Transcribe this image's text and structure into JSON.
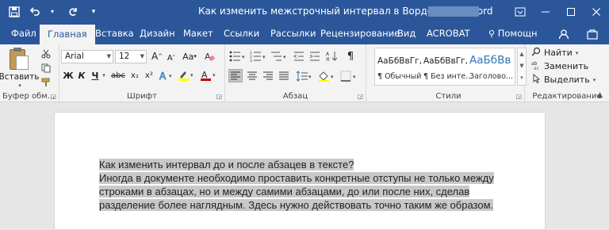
{
  "window": {
    "title": "Как изменить межстрочный интервал в Ворде.docx - Word",
    "buttons": [
      "ribbon-display-icon",
      "minimize-icon",
      "maximize-icon",
      "close-icon"
    ]
  },
  "qat": {
    "icons": [
      "save-icon",
      "undo-icon",
      "redo-icon",
      "customize-icon"
    ]
  },
  "tabs": [
    {
      "label": "Файл"
    },
    {
      "label": "Главная"
    },
    {
      "label": "Вставка"
    },
    {
      "label": "Дизайн"
    },
    {
      "label": "Макет"
    },
    {
      "label": "Ссылки"
    },
    {
      "label": "Рассылки"
    },
    {
      "label": "Рецензирование"
    },
    {
      "label": "Вид"
    },
    {
      "label": "ACROBAT"
    },
    {
      "label": "Помощн"
    }
  ],
  "ribbon": {
    "clipboard": {
      "paste_label": "Вставить",
      "group_label": "Буфер обм..."
    },
    "font": {
      "font_name": "Arial",
      "font_size": "12",
      "group_label": "Шрифт",
      "bold": "Ж",
      "italic": "К",
      "underline": "Ч",
      "strike": "abc",
      "subscript": "x₂",
      "superscript": "x²",
      "grow": "A",
      "shrink": "A",
      "case": "Aa"
    },
    "paragraph": {
      "group_label": "Абзац",
      "pilcrow": "¶"
    },
    "styles": {
      "group_label": "Стили",
      "items": [
        {
          "sample": "АаБбВвГг,",
          "name": "¶ Обычный"
        },
        {
          "sample": "АаБбВвГг,",
          "name": "¶ Без инте..."
        },
        {
          "sample": "АаБбВв",
          "name": "Заголово..."
        }
      ]
    },
    "editing": {
      "group_label": "Редактирование",
      "find": "Найти",
      "replace": "Заменить",
      "select": "Выделить"
    }
  },
  "document": {
    "lines": [
      "Как изменить интервал до и после абзацев в тексте?",
      "Иногда в документе необходимо проставить конкретные отступы не только между",
      "строками в абзацах, но и между самими абзацами, до или после них, сделав",
      "разделение более наглядным. Здесь нужно действовать точно таким же образом."
    ]
  },
  "colors": {
    "accent": "#2b579a",
    "ribbon_bg": "#f3f3f3",
    "doc_bg": "#e6e6e6",
    "selection": "#c8c8c8",
    "heading_style": "#2e74b5",
    "font_color": "#c00000",
    "highlight": "#ffff00"
  }
}
